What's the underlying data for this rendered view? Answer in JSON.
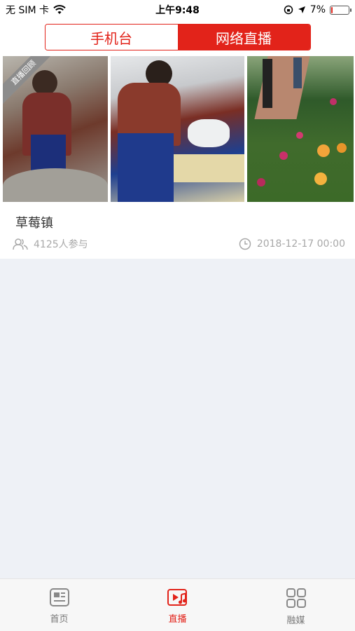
{
  "status": {
    "carrier": "无 SIM 卡",
    "time": "上午9:48",
    "battery": "7%",
    "battery_level": 0.07
  },
  "header": {
    "tabs": [
      {
        "label": "手机台",
        "active": false
      },
      {
        "label": "网络直播",
        "active": true
      }
    ]
  },
  "live_list": [
    {
      "badge": "直播回顾",
      "title": "草莓镇",
      "participants": "4125人参与",
      "datetime": "2018-12-17 00:00"
    }
  ],
  "tabbar": {
    "items": [
      {
        "label": "首页",
        "icon": "news-icon",
        "active": false
      },
      {
        "label": "直播",
        "icon": "live-video-icon",
        "active": true
      },
      {
        "label": "融媒",
        "icon": "grid-icon",
        "active": false
      }
    ]
  },
  "colors": {
    "accent": "#e2231a",
    "background": "#eef1f6"
  }
}
